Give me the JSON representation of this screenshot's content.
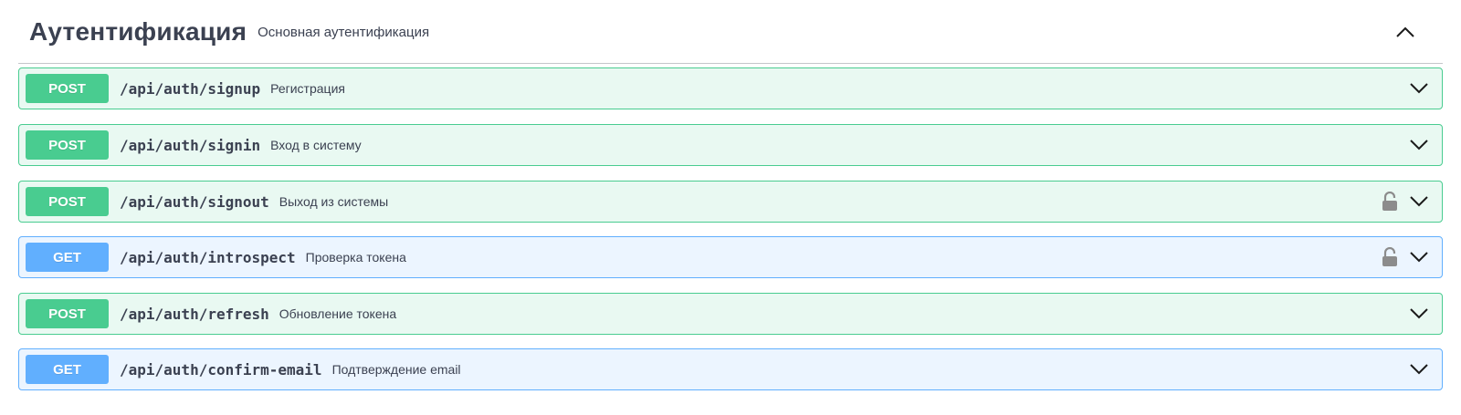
{
  "tag": {
    "title": "Аутентификация",
    "description": "Основная аутентификация",
    "toggle_icon": "chevron-up-icon"
  },
  "colors": {
    "post": "#49cc90",
    "get": "#61affe",
    "text": "#3b4151"
  },
  "operations": [
    {
      "method": "POST",
      "path": "/api/auth/signup",
      "summary": "Регистрация",
      "locked": false
    },
    {
      "method": "POST",
      "path": "/api/auth/signin",
      "summary": "Вход в систему",
      "locked": false
    },
    {
      "method": "POST",
      "path": "/api/auth/signout",
      "summary": "Выход из системы",
      "locked": true
    },
    {
      "method": "GET",
      "path": "/api/auth/introspect",
      "summary": "Проверка токена",
      "locked": true
    },
    {
      "method": "POST",
      "path": "/api/auth/refresh",
      "summary": "Обновление токена",
      "locked": false
    },
    {
      "method": "GET",
      "path": "/api/auth/confirm-email",
      "summary": "Подтверждение email",
      "locked": false
    }
  ]
}
